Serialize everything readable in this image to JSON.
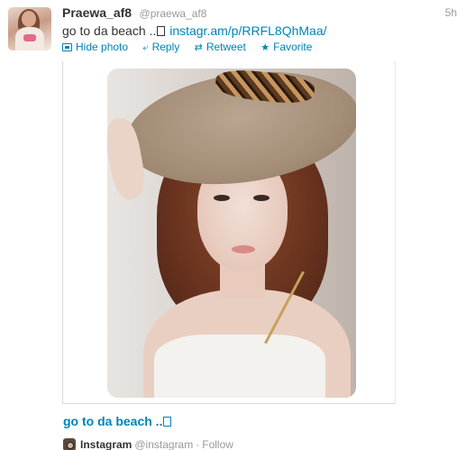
{
  "tweet": {
    "fullname": "Praewa_af8",
    "username": "@praewa_af8",
    "time": "5h",
    "text_prefix": "go to da beach ..",
    "link": "instagr.am/p/RRFL8QhMaa/"
  },
  "actions": {
    "hide_photo": "Hide photo",
    "reply": "Reply",
    "retweet": "Retweet",
    "favorite": "Favorite"
  },
  "media": {
    "caption": "go to da beach .."
  },
  "attribution": {
    "service": "Instagram",
    "handle": "@instagram",
    "separator": "·",
    "follow": "Follow"
  },
  "colors": {
    "link": "#0084b4",
    "muted": "#999999",
    "text": "#333333"
  }
}
